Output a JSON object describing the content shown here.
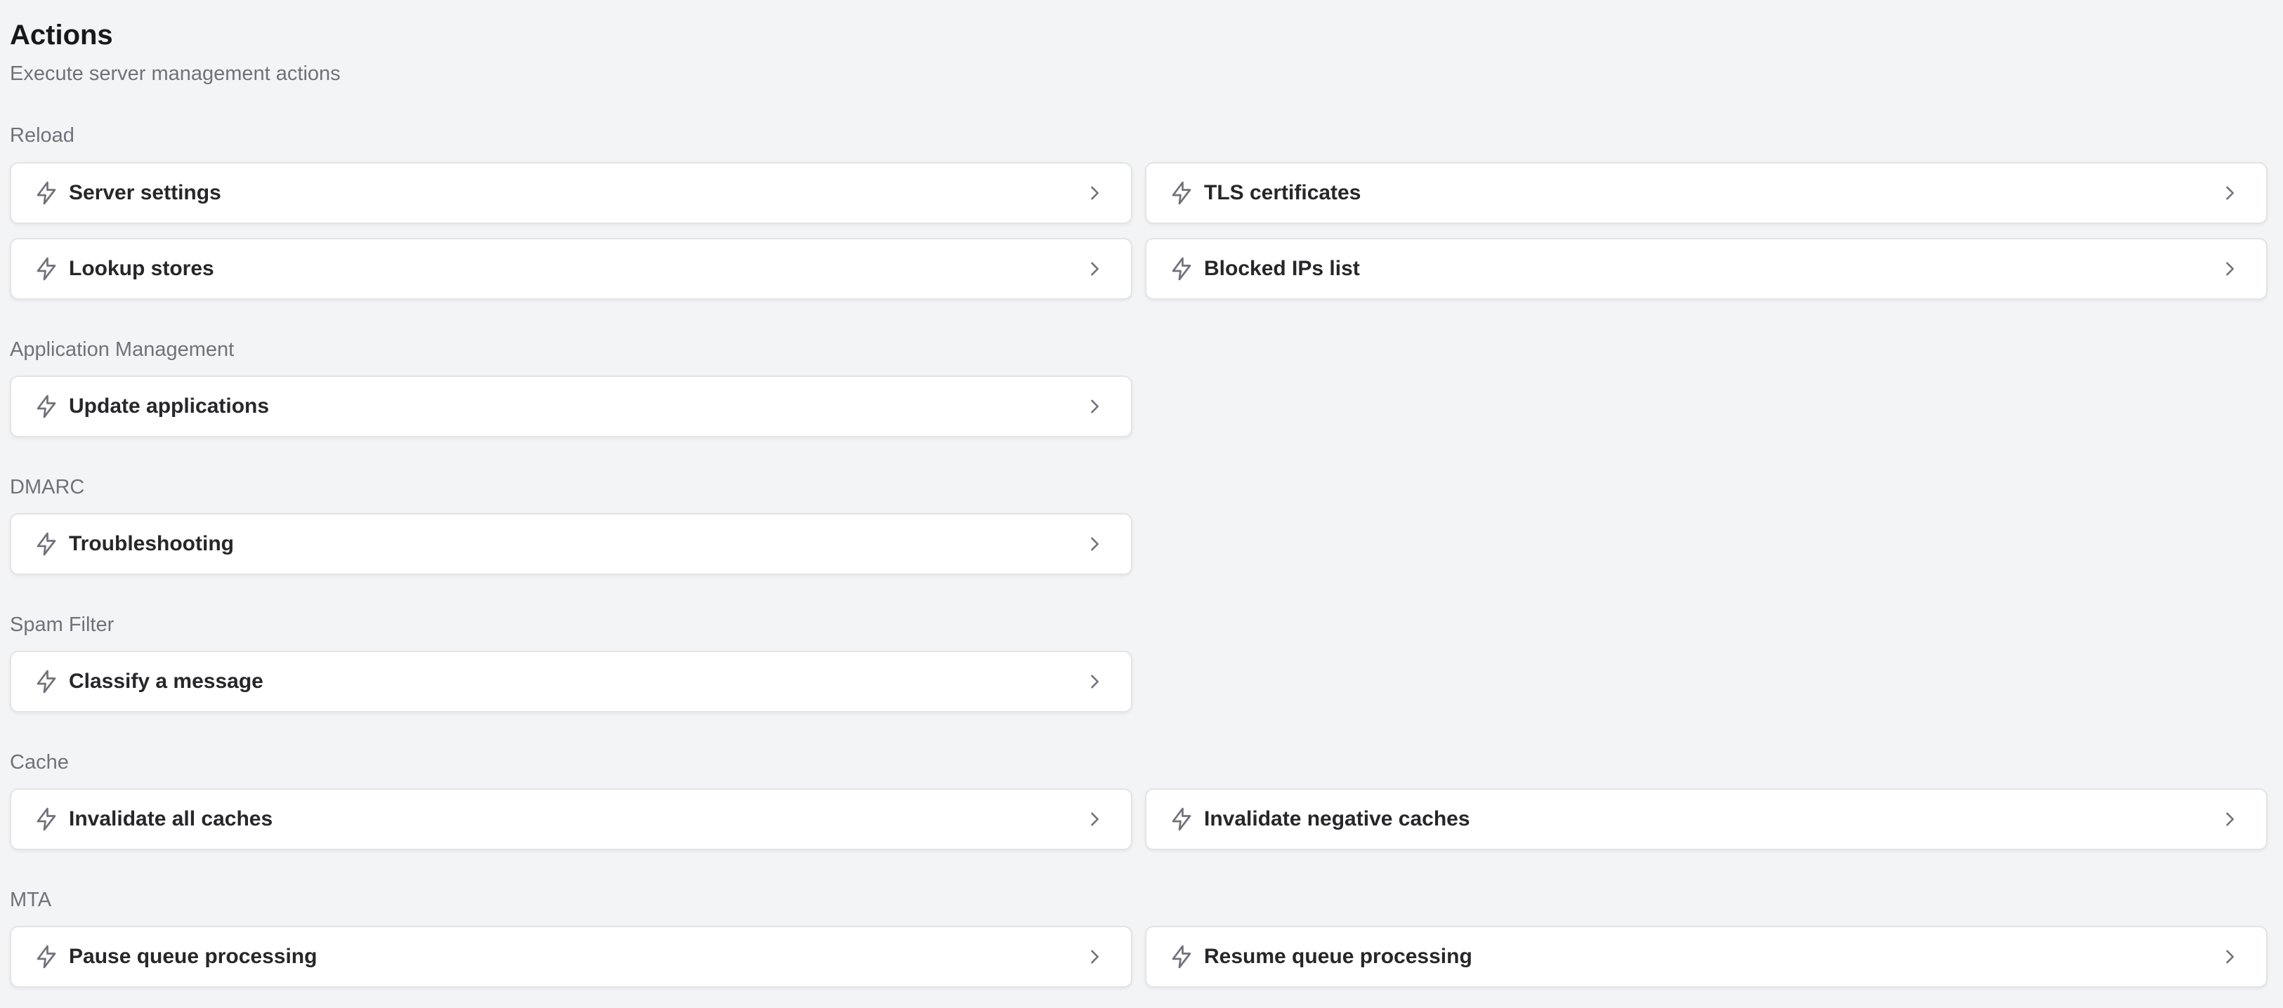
{
  "header": {
    "title": "Actions",
    "subtitle": "Execute server management actions"
  },
  "colors": {
    "background": "#f3f4f6",
    "card": "#ffffff",
    "muted_text": "#71717a",
    "icon": "#71717a"
  },
  "icons": {
    "action": "lightning-bolt-icon",
    "open": "chevron-right-icon"
  },
  "sections": [
    {
      "label": "Reload",
      "actions": [
        {
          "label": "Server settings"
        },
        {
          "label": "TLS certificates"
        },
        {
          "label": "Lookup stores"
        },
        {
          "label": "Blocked IPs list"
        }
      ]
    },
    {
      "label": "Application Management",
      "actions": [
        {
          "label": "Update applications"
        }
      ]
    },
    {
      "label": "DMARC",
      "actions": [
        {
          "label": "Troubleshooting"
        }
      ]
    },
    {
      "label": "Spam Filter",
      "actions": [
        {
          "label": "Classify a message"
        }
      ]
    },
    {
      "label": "Cache",
      "actions": [
        {
          "label": "Invalidate all caches"
        },
        {
          "label": "Invalidate negative caches"
        }
      ]
    },
    {
      "label": "MTA",
      "actions": [
        {
          "label": "Pause queue processing"
        },
        {
          "label": "Resume queue processing"
        }
      ]
    }
  ]
}
